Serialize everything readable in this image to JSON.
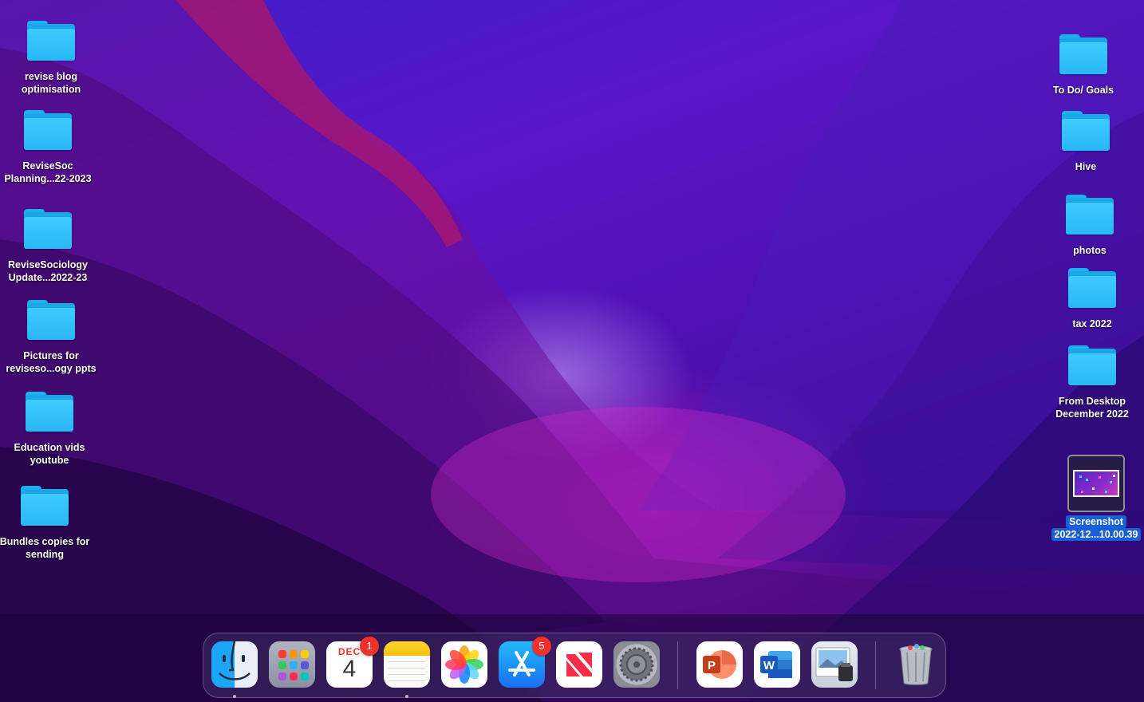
{
  "desktop": {
    "left_items": [
      {
        "label": "revise blog\noptimisation",
        "icon": "folder-icon"
      },
      {
        "label": "ReviseSoc\nPlanning...22-2023",
        "icon": "folder-icon"
      },
      {
        "label": "ReviseSociology\nUpdate...2022-23",
        "icon": "folder-icon"
      },
      {
        "label": "Pictures for\nreviseso...ogy ppts",
        "icon": "folder-icon"
      },
      {
        "label": "Education vids\nyoutube",
        "icon": "folder-icon"
      },
      {
        "label": "Bundles copies for\nsending",
        "icon": "folder-icon"
      }
    ],
    "right_items": [
      {
        "label": "To Do/ Goals",
        "icon": "folder-icon"
      },
      {
        "label": "Hive",
        "icon": "folder-icon"
      },
      {
        "label": "photos",
        "icon": "folder-icon"
      },
      {
        "label": "tax 2022",
        "icon": "folder-icon"
      },
      {
        "label": "From Desktop\nDecember 2022",
        "icon": "folder-icon"
      }
    ],
    "screenshot_file": {
      "label_line1": "Screenshot",
      "label_line2": "2022-12...10.00.39",
      "selected": true,
      "icon": "image-thumbnail-icon"
    }
  },
  "dock": {
    "apps": [
      {
        "name": "Finder",
        "icon": "finder-icon",
        "running": true
      },
      {
        "name": "Launchpad",
        "icon": "launchpad-icon",
        "running": false
      },
      {
        "name": "Calendar",
        "icon": "calendar-icon",
        "month": "DEC",
        "day": "4",
        "badge": "1",
        "running": false
      },
      {
        "name": "Notes",
        "icon": "notes-icon",
        "running": true
      },
      {
        "name": "Photos",
        "icon": "photos-icon",
        "running": false
      },
      {
        "name": "App Store",
        "icon": "app-store-icon",
        "badge": "5",
        "running": false
      },
      {
        "name": "News",
        "icon": "news-icon",
        "running": false
      },
      {
        "name": "System Preferences",
        "icon": "gear-icon",
        "running": false
      },
      {
        "name": "Microsoft PowerPoint",
        "icon": "powerpoint-icon",
        "letter": "P",
        "running": false
      },
      {
        "name": "Microsoft Word",
        "icon": "word-icon",
        "letter": "W",
        "running": false
      },
      {
        "name": "Preview",
        "icon": "preview-icon",
        "running": false
      },
      {
        "name": "Trash",
        "icon": "trash-icon",
        "running": false
      }
    ]
  },
  "colors": {
    "folder": "#27b8f5",
    "selection": "#1a5fd6",
    "badge": "#f0312b"
  }
}
